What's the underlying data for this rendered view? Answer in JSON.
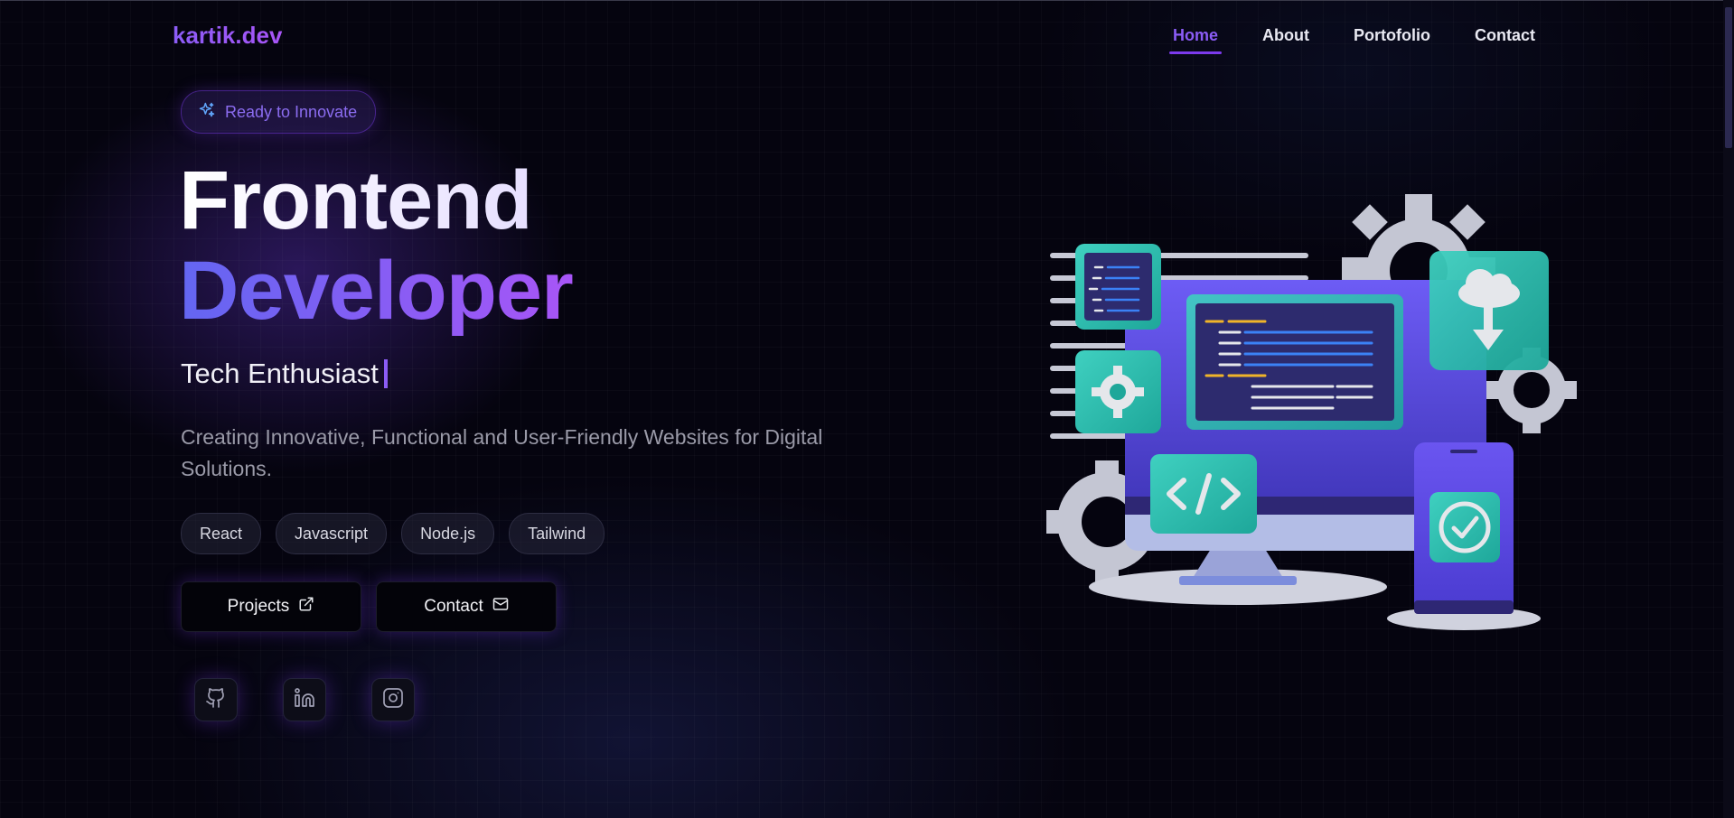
{
  "nav": {
    "logo": "kartik.dev",
    "items": [
      {
        "label": "Home",
        "active": true
      },
      {
        "label": "About",
        "active": false
      },
      {
        "label": "Portofolio",
        "active": false
      },
      {
        "label": "Contact",
        "active": false
      }
    ]
  },
  "hero": {
    "badge": "Ready to Innovate",
    "title_line1": "Frontend",
    "title_line2": "Developer",
    "tagline": "Tech Enthusiast",
    "description": "Creating Innovative, Functional and User-Friendly Websites for Digital Solutions.",
    "skills": [
      "React",
      "Javascript",
      "Node.js",
      "Tailwind"
    ],
    "buttons": {
      "projects": "Projects",
      "contact": "Contact"
    },
    "socials": [
      {
        "icon": "github-icon"
      },
      {
        "icon": "linkedin-icon"
      },
      {
        "icon": "instagram-icon"
      }
    ]
  },
  "colors": {
    "accent": "#8b5cf6",
    "accent_dark": "#7c3aed",
    "background": "#05040f",
    "teal": "#2dd4bf"
  }
}
